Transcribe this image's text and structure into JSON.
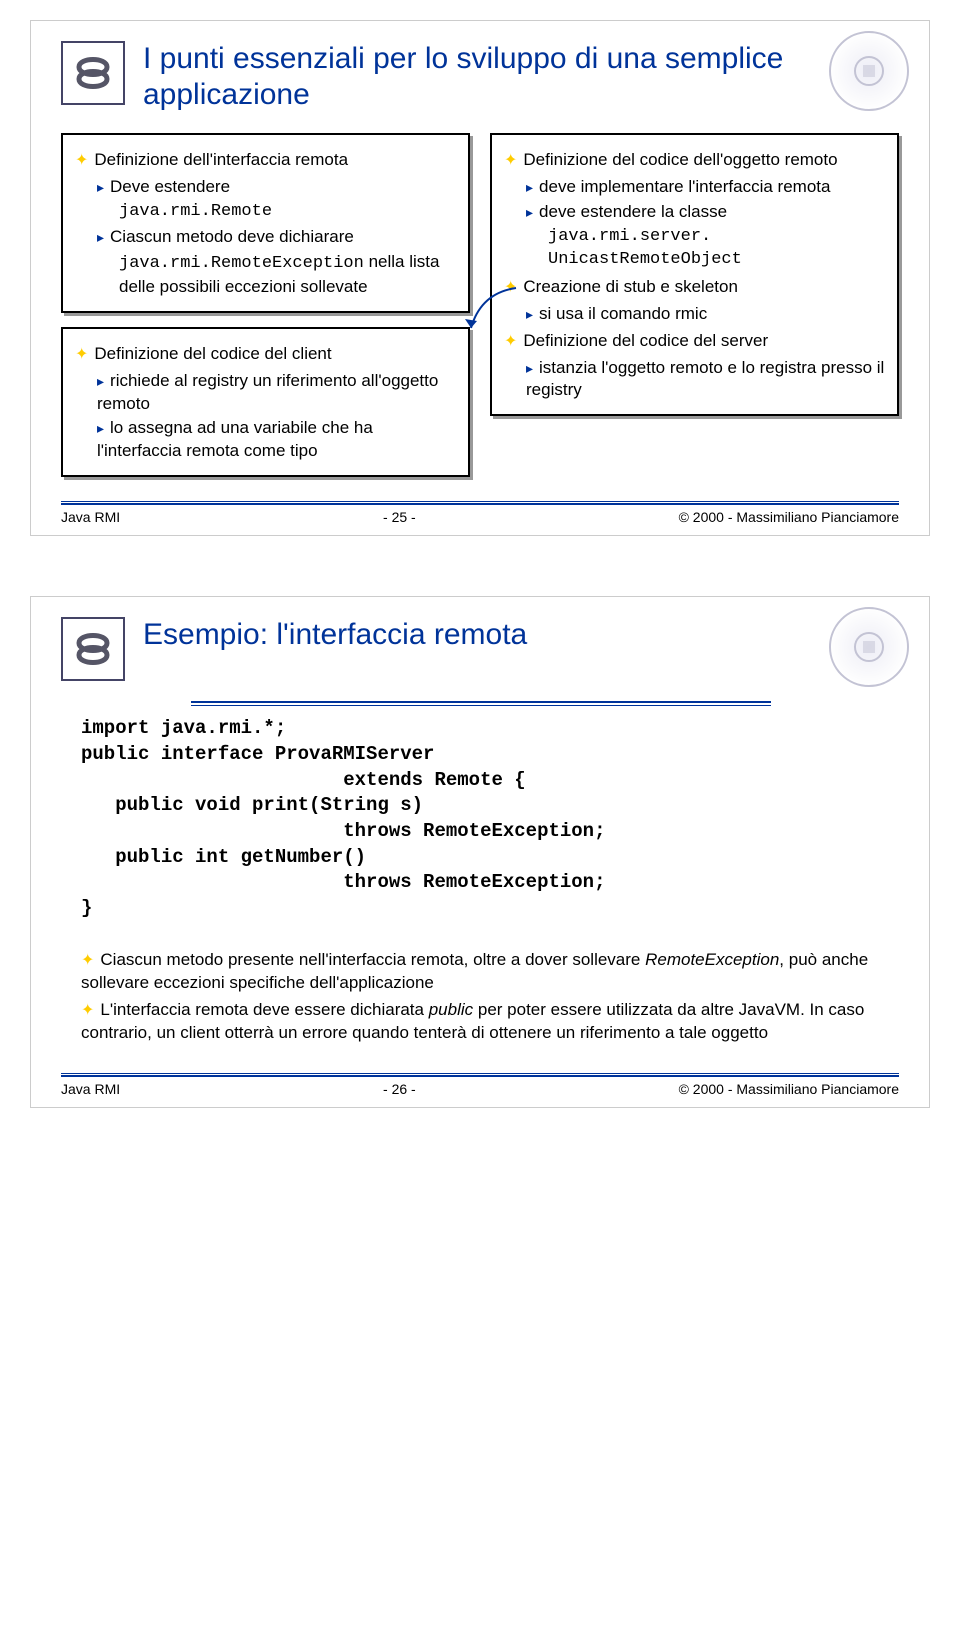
{
  "slide1": {
    "title": "I punti essenziali per lo sviluppo di una semplice applicazione",
    "left": {
      "box1": {
        "heading": "Definizione dell'interfaccia remota",
        "item1": "Deve estendere",
        "code1": "java.rmi.Remote",
        "item2": "Ciascun metodo deve dichiarare",
        "code2": "java.rmi.RemoteException",
        "item2b": "nella lista delle possibili eccezioni sollevate"
      },
      "box2": {
        "heading": "Definizione del codice del client",
        "item1": "richiede al registry un riferimento all'oggetto remoto",
        "item2": "lo assegna ad una variabile che ha l'interfaccia remota come tipo"
      }
    },
    "right": {
      "heading": "Definizione del codice dell'oggetto remoto",
      "item1": "deve implementare l'interfaccia remota",
      "item2a": "deve estendere la classe",
      "item2code": "java.rmi.server. UnicastRemoteObject",
      "item3": "Creazione di stub e skeleton",
      "item3a": "si usa il comando rmic",
      "item4": "Definizione del codice del server",
      "item4a": "istanzia l'oggetto remoto e lo registra presso il registry"
    },
    "footer": {
      "left": "Java RMI",
      "center": "- 25 -",
      "right": "© 2000 - Massimiliano Pianciamore"
    }
  },
  "slide2": {
    "title": "Esempio: l'interfaccia remota",
    "code": "import java.rmi.*;\npublic interface ProvaRMIServer\n                       extends Remote {\n   public void print(String s)\n                       throws RemoteException;\n   public int getNumber()\n                       throws RemoteException;\n}",
    "bullet1a": "Ciascun metodo presente nell'interfaccia remota, oltre a dover sollevare ",
    "bullet1b": "RemoteException",
    "bullet1c": ", può anche sollevare eccezioni specifiche dell'applicazione",
    "bullet2a": "L'interfaccia remota deve essere dichiarata ",
    "bullet2b": "public",
    "bullet2c": " per poter essere utilizzata da altre JavaVM. In caso contrario, un client otterrà un errore quando tenterà di ottenere un riferimento a tale oggetto",
    "footer": {
      "left": "Java RMI",
      "center": "- 26 -",
      "right": "© 2000 - Massimiliano Pianciamore"
    }
  }
}
